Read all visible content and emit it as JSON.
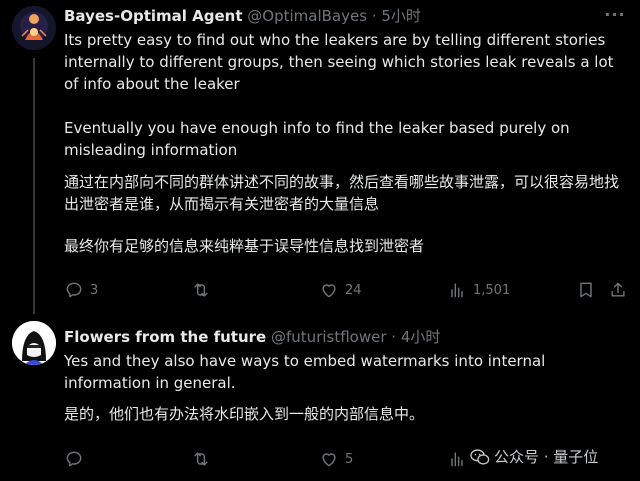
{
  "tweets": [
    {
      "name": "Bayes-Optimal Agent",
      "handle": "@OptimalBayes",
      "separator": "·",
      "time": "5小时",
      "more": "···",
      "paragraphs": [
        "Its pretty easy to find out who the leakers are by telling different stories internally to different groups, then seeing which stories leak reveals a lot of info about the leaker",
        "Eventually you have enough info to find the leaker based purely on misleading information",
        "通过在内部向不同的群体讲述不同的故事，然后查看哪些故事泄露，可以很容易地找出泄密者是谁，从而揭示有关泄密者的大量信息",
        "最终你有足够的信息来纯粹基于误导性信息找到泄密者"
      ],
      "actions": {
        "replies": "3",
        "retweets": "",
        "likes": "24",
        "views": "1,501"
      }
    },
    {
      "name": "Flowers from the future",
      "handle": "@futuristflower",
      "separator": "·",
      "time": "4小时",
      "paragraphs": [
        "Yes and they also have ways to embed watermarks into internal information in general.",
        "是的，他们也有办法将水印嵌入到一般的内部信息中。"
      ],
      "actions": {
        "replies": "",
        "retweets": "",
        "likes": "5",
        "views": ""
      }
    }
  ],
  "watermark": {
    "text": "公众号 · 量子位"
  },
  "colors": {
    "background": "#000000",
    "text": "#e7e9ea",
    "muted": "#71767b",
    "divider": "#333639"
  }
}
